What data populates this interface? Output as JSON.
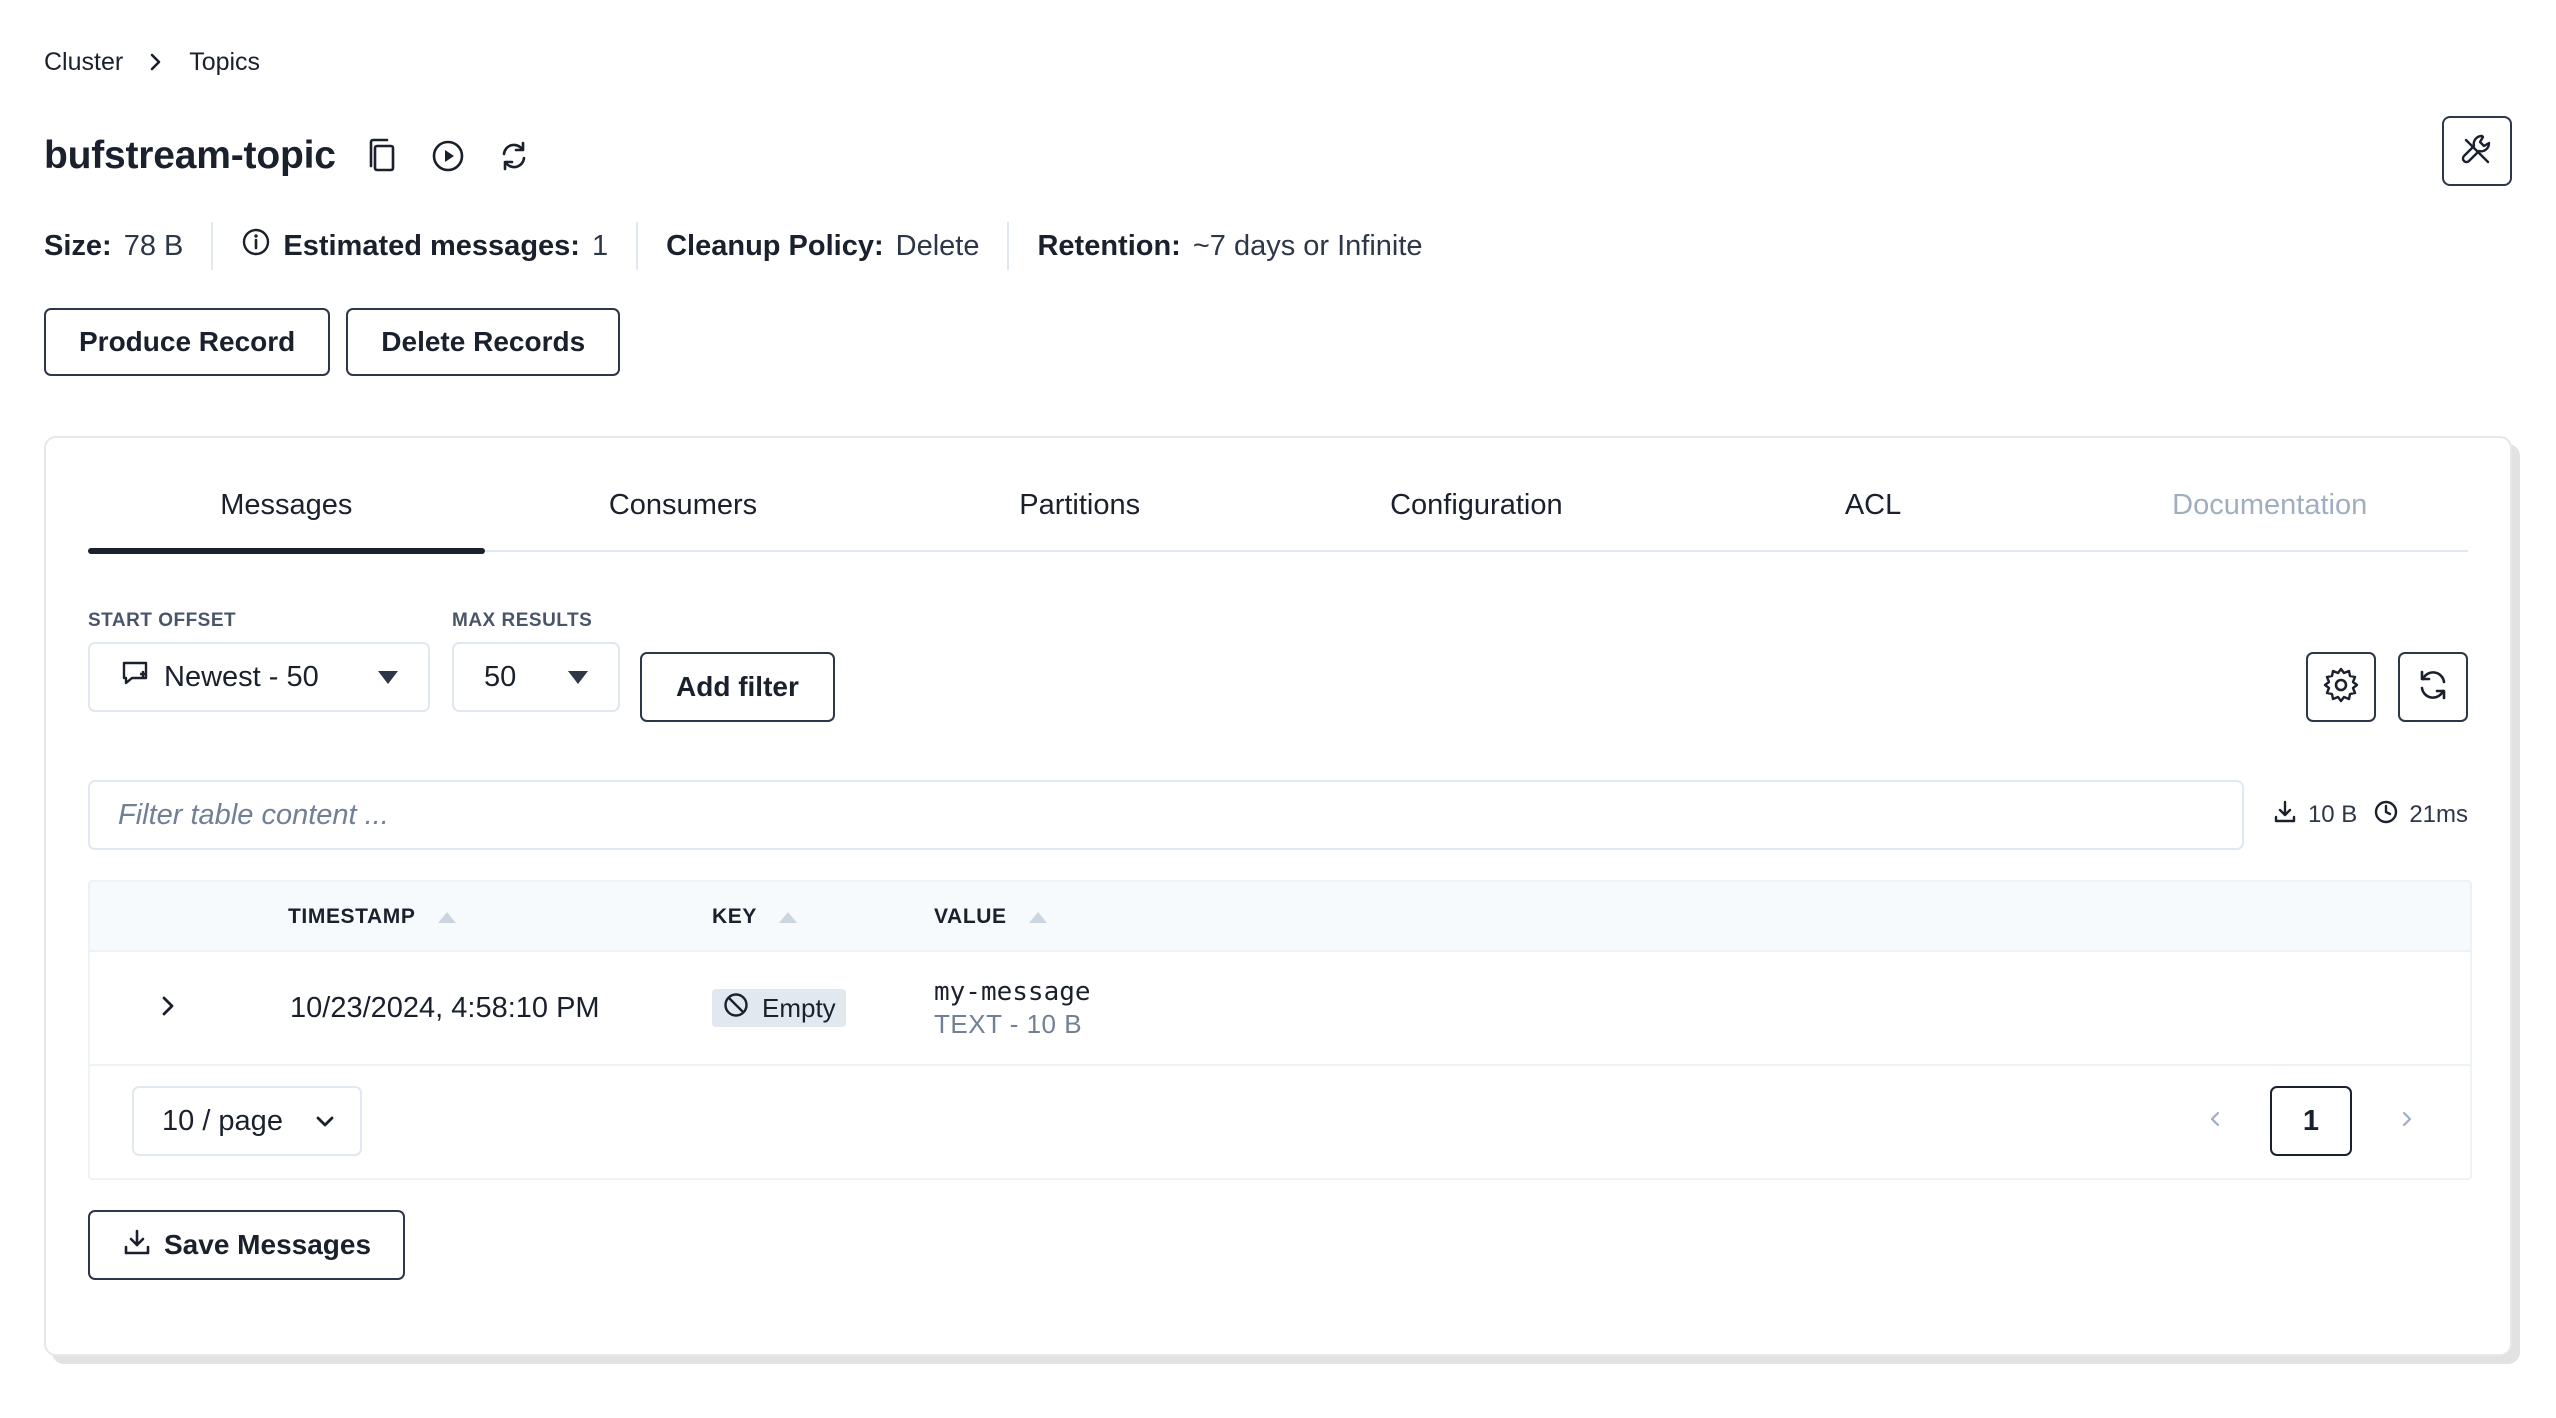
{
  "breadcrumb": {
    "items": [
      "Cluster",
      "Topics"
    ]
  },
  "topic": {
    "title": "bufstream-topic"
  },
  "stats": {
    "size_label": "Size:",
    "size_value": "78 B",
    "messages_label": "Estimated messages:",
    "messages_value": "1",
    "cleanup_label": "Cleanup Policy:",
    "cleanup_value": "Delete",
    "retention_label": "Retention:",
    "retention_value": "~7 days or Infinite"
  },
  "actions": {
    "produce": "Produce Record",
    "delete": "Delete Records"
  },
  "tabs": [
    {
      "label": "Messages"
    },
    {
      "label": "Consumers"
    },
    {
      "label": "Partitions"
    },
    {
      "label": "Configuration"
    },
    {
      "label": "ACL"
    },
    {
      "label": "Documentation"
    }
  ],
  "controls": {
    "start_offset_label": "START OFFSET",
    "start_offset_value": "Newest - 50",
    "max_results_label": "MAX RESULTS",
    "max_results_value": "50",
    "add_filter": "Add filter"
  },
  "filter": {
    "placeholder": "Filter table content ...",
    "bytes": "10 B",
    "time": "21ms"
  },
  "table": {
    "columns": [
      "TIMESTAMP",
      "KEY",
      "VALUE"
    ],
    "rows": [
      {
        "timestamp": "10/23/2024, 4:58:10 PM",
        "key": "Empty",
        "value": "my-message",
        "value_meta": "TEXT - 10 B"
      }
    ]
  },
  "pagination": {
    "page_size": "10 / page",
    "current_page": "1"
  },
  "save": {
    "label": "Save Messages"
  },
  "colors": {
    "text": "#1a202c",
    "border_dark": "#2d3748",
    "border_light": "#e2e8f0",
    "muted": "#718096",
    "disabled": "#a0aec0"
  }
}
